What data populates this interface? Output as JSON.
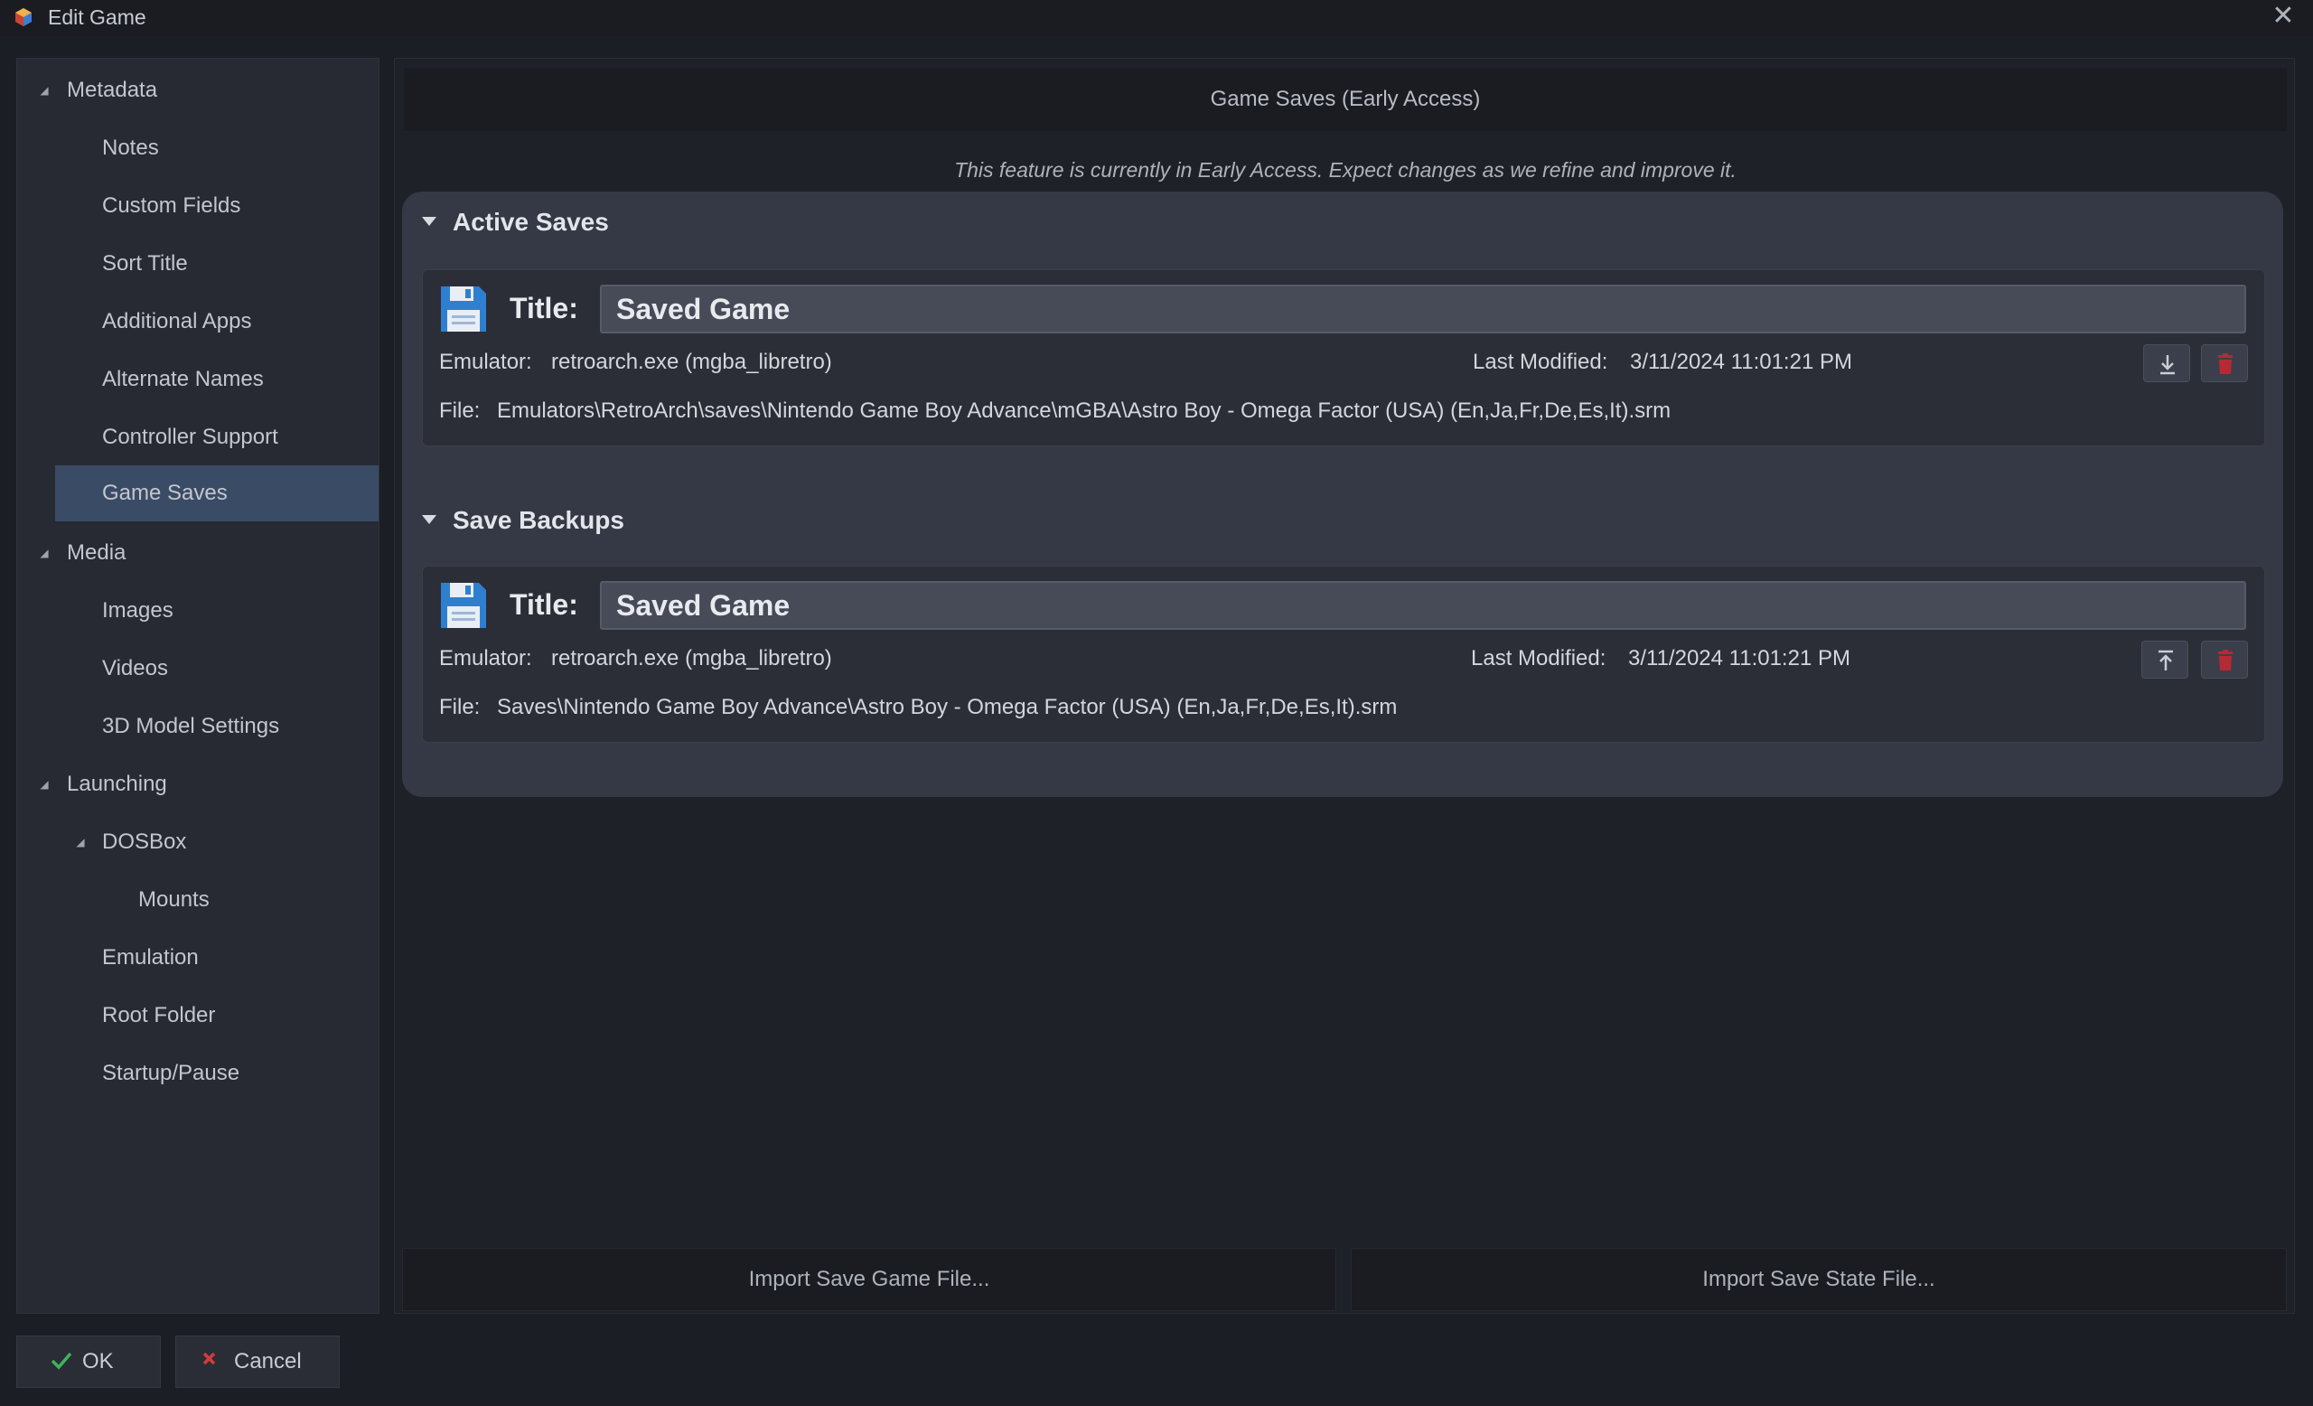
{
  "window": {
    "title": "Edit Game",
    "close_symbol": "✕"
  },
  "sidebar": {
    "items": [
      {
        "label": "Metadata",
        "level": 0,
        "expanded": true
      },
      {
        "label": "Notes",
        "level": 1
      },
      {
        "label": "Custom Fields",
        "level": 1
      },
      {
        "label": "Sort Title",
        "level": 1
      },
      {
        "label": "Additional Apps",
        "level": 1
      },
      {
        "label": "Alternate Names",
        "level": 1
      },
      {
        "label": "Controller Support",
        "level": 1
      },
      {
        "label": "Game Saves",
        "level": 1,
        "selected": true
      },
      {
        "label": "Media",
        "level": 0,
        "expanded": true
      },
      {
        "label": "Images",
        "level": 1
      },
      {
        "label": "Videos",
        "level": 1
      },
      {
        "label": "3D Model Settings",
        "level": 1
      },
      {
        "label": "Launching",
        "level": 0,
        "expanded": true
      },
      {
        "label": "DOSBox",
        "level": 1,
        "expanded": true
      },
      {
        "label": "Mounts",
        "level": 2
      },
      {
        "label": "Emulation",
        "level": 1
      },
      {
        "label": "Root Folder",
        "level": 1
      },
      {
        "label": "Startup/Pause",
        "level": 1
      }
    ]
  },
  "main": {
    "header": "Game Saves (Early Access)",
    "note": "This feature is currently in Early Access. Expect changes as we refine and improve it.",
    "active_saves": {
      "heading": "Active Saves",
      "card": {
        "title_label": "Title:",
        "title_value": "Saved Game",
        "emulator_label": "Emulator:",
        "emulator_value": "retroarch.exe (mgba_libretro)",
        "modified_label": "Last Modified:",
        "modified_value": "3/11/2024 11:01:21 PM",
        "file_label": "File:",
        "file_value": "Emulators\\RetroArch\\saves\\Nintendo Game Boy Advance\\mGBA\\Astro Boy - Omega Factor (USA) (En,Ja,Fr,De,Es,It).srm",
        "action_icon": "download-icon"
      }
    },
    "save_backups": {
      "heading": "Save Backups",
      "card": {
        "title_label": "Title:",
        "title_value": "Saved Game",
        "emulator_label": "Emulator:",
        "emulator_value": "retroarch.exe (mgba_libretro)",
        "modified_label": "Last Modified:",
        "modified_value": "3/11/2024 11:01:21 PM",
        "file_label": "File:",
        "file_value": "Saves\\Nintendo Game Boy Advance\\Astro Boy - Omega Factor (USA) (En,Ja,Fr,De,Es,It).srm",
        "action_icon": "restore-upload-icon"
      }
    },
    "import_save_game": "Import Save Game File...",
    "import_save_state": "Import Save State File..."
  },
  "footer": {
    "ok_label": "OK",
    "cancel_label": "Cancel"
  },
  "colors": {
    "selected": "#3a4b66",
    "delete_red": "#b52a35",
    "disk_blue": "#2f7fd1",
    "ok_green": "#3cb55c",
    "cancel_red": "#d23b3b"
  }
}
